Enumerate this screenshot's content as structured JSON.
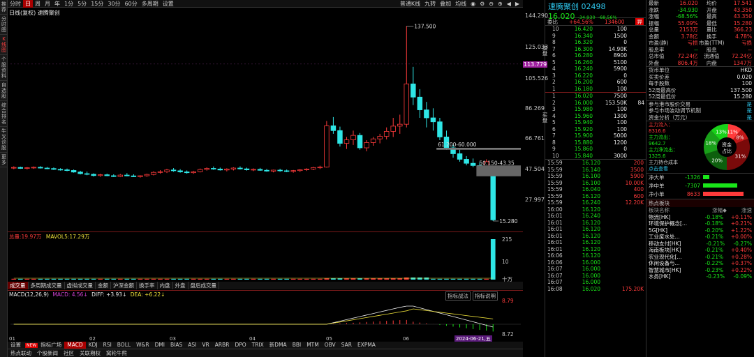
{
  "left_strip": [
    "推荐",
    "分时图",
    "K线图",
    "个股资料",
    "自选股",
    "综合排名",
    "牛叉诊股",
    "更多"
  ],
  "top_tabs": [
    "分时",
    "日",
    "周",
    "月",
    "年",
    "1分",
    "5分",
    "15分",
    "30分",
    "60分",
    "多周期",
    "设置"
  ],
  "top_right": [
    "普通K线",
    "九转",
    "叠加",
    "均线"
  ],
  "chart_title": "日线(复权)  速腾聚创",
  "price_axis": [
    "144.290",
    "125.033",
    "113.779",
    "105.526",
    "86.269",
    "66.761",
    "47.504",
    "27.997"
  ],
  "annotations": {
    "high": "137.500",
    "mark1": "61.200-60.000",
    "mark2": "50.150-43.35",
    "low": "15.280"
  },
  "vol_header": {
    "label": "总量:",
    "value": "19.97万",
    "mavol_label": "MAVOL5:",
    "mavol": "17.29万"
  },
  "vol_axis": [
    "215",
    "10",
    "十万"
  ],
  "vol_tabs": [
    "成交量",
    "多周期成交量",
    "虚拟成交量",
    "金额",
    "沪深金额",
    "换手率",
    "内盘",
    "外盘",
    "盘后成交量"
  ],
  "macd_header": {
    "label": "MACD(12,26,9)",
    "macd": "MACD: 4.56↓",
    "diff": "DIFF: +3.93↓",
    "dea": "DEA: +6.22↓"
  },
  "macd_buttons": [
    "指标战法",
    "指标说明"
  ],
  "macd_axis": [
    "8.79",
    "8.72"
  ],
  "date_axis": [
    "01",
    "02",
    "03",
    "04",
    "05",
    "06",
    "2024-06-21,五"
  ],
  "indicator_tabs": [
    "设置",
    "指标广场",
    "MACD",
    "KDJ",
    "RSI",
    "BOLL",
    "W&R",
    "DMI",
    "BIAS",
    "ASI",
    "VR",
    "ARBR",
    "DPO",
    "TRIX",
    "新DMA",
    "BBI",
    "MTM",
    "OBV",
    "SAR",
    "EXPMA"
  ],
  "new_badge": "NEW",
  "bottom_tabs": [
    "热点联动",
    "个股新闻",
    "社区",
    "关联期权",
    "窝轮牛熊"
  ],
  "stock": {
    "name": "速腾聚创",
    "code": "02498",
    "price": "16.020",
    "change": "-34.930",
    "pct": "-68.56%"
  },
  "weibi": {
    "label": "委比",
    "value": "+64.56%",
    "vol": "134600",
    "tag": "异"
  },
  "asks": [
    [
      "10",
      "16.420",
      "100"
    ],
    [
      "9",
      "16.340",
      "1500"
    ],
    [
      "8",
      "16.320",
      "0"
    ],
    [
      "7",
      "16.300",
      "14.90K"
    ],
    [
      "6",
      "16.280",
      "8900"
    ],
    [
      "5",
      "16.260",
      "5100"
    ],
    [
      "4",
      "16.240",
      "5900"
    ],
    [
      "3",
      "16.220",
      "0"
    ],
    [
      "2",
      "16.200",
      "600"
    ],
    [
      "1",
      "16.180",
      "100"
    ]
  ],
  "bids": [
    [
      "1",
      "16.020",
      "7500"
    ],
    [
      "2",
      "16.000",
      "153.50K"
    ],
    [
      "3",
      "15.980",
      "100"
    ],
    [
      "4",
      "15.960",
      "1300"
    ],
    [
      "5",
      "15.940",
      "100"
    ],
    [
      "6",
      "15.920",
      "100"
    ],
    [
      "7",
      "15.900",
      "5000"
    ],
    [
      "8",
      "15.880",
      "1200"
    ],
    [
      "9",
      "15.860",
      "0"
    ],
    [
      "10",
      "15.840",
      "3000"
    ]
  ],
  "bid_side_extra": "84",
  "ask_label": "卖盘",
  "bid_label": "买盘",
  "ticks": [
    [
      "15:59",
      "16.120",
      "200"
    ],
    [
      "15:59",
      "16.140",
      "3500"
    ],
    [
      "15:59",
      "16.100",
      "5900"
    ],
    [
      "15:59",
      "16.100",
      "10.00K"
    ],
    [
      "15:59",
      "16.040",
      "400"
    ],
    [
      "15:59",
      "16.120",
      "600"
    ],
    [
      "15:59",
      "16.240",
      "12.20K"
    ],
    [
      "16:00",
      "16.120",
      ""
    ],
    [
      "16:01",
      "16.240",
      ""
    ],
    [
      "16:01",
      "16.120",
      ""
    ],
    [
      "16:01",
      "16.120",
      ""
    ],
    [
      "16:01",
      "16.120",
      ""
    ],
    [
      "16:01",
      "16.120",
      ""
    ],
    [
      "16:01",
      "16.120",
      ""
    ],
    [
      "16:06",
      "16.120",
      ""
    ],
    [
      "16:06",
      "16.000",
      ""
    ],
    [
      "16:07",
      "16.000",
      ""
    ],
    [
      "16:07",
      "16.000",
      ""
    ],
    [
      "16:07",
      "16.000",
      ""
    ],
    [
      "16:08",
      "16.020",
      "175.20K"
    ]
  ],
  "quote": [
    [
      "最新",
      "16.020",
      "均价",
      "17.541"
    ],
    [
      "涨跌",
      "-34.930",
      "开盘",
      "43.350"
    ],
    [
      "涨幅",
      "-68.56%",
      "最高",
      "43.350"
    ],
    [
      "振幅",
      "55.09%",
      "最低",
      "15.280"
    ],
    [
      "总量",
      "2153万",
      "量比",
      "366.23"
    ],
    [
      "金额",
      "3.78亿",
      "换手",
      "4.78%"
    ],
    [
      "市盈(静)",
      "亏损",
      "市盈(TTM)",
      "亏损"
    ],
    [
      "股息率",
      "--",
      "股息",
      "--"
    ],
    [
      "总市值",
      "72.24亿",
      "流通值",
      "72.24亿"
    ],
    [
      "外盘",
      "806.4万",
      "内盘",
      "1347万"
    ]
  ],
  "extra": [
    [
      "货币单位",
      "HKD"
    ],
    [
      "买卖价差",
      "0.020"
    ],
    [
      "每手股数",
      "100"
    ],
    [
      "52周最高价",
      "137.500"
    ],
    [
      "52周最低价",
      "15.280"
    ]
  ],
  "links": [
    [
      "参与港市股价交易",
      "是"
    ],
    [
      "参与市场波动调节机制",
      "是"
    ],
    [
      "资金分析（万元）",
      "是"
    ]
  ],
  "fund_flow": {
    "in_label": "主力流入：",
    "in": "8316.6",
    "out_label": "主力流出：",
    "out": "9642.7",
    "net_label": "主力净流出：",
    "net": "1325.6",
    "cost_label": "主力持仓成本",
    "link": "点击查看"
  },
  "pie": {
    "center1": "资金",
    "center2": "占比",
    "slices": [
      [
        "11%",
        "#ff3b3b"
      ],
      [
        "8%",
        "#c01818"
      ],
      [
        "31%",
        "#7a0a0a"
      ],
      [
        "20%",
        "#0d5f0d"
      ],
      [
        "18%",
        "#19a019"
      ],
      [
        "13%",
        "#19d219"
      ]
    ]
  },
  "net": [
    [
      "净大单",
      "-1326",
      "#19e619"
    ],
    [
      "净中单",
      "-7307",
      "#19e619"
    ],
    [
      "净小单",
      "8633",
      "#ff3b3b"
    ]
  ],
  "hot": {
    "title": "热点板块",
    "headers": [
      "板块名称",
      "涨幅◆",
      "涨速"
    ],
    "rows": [
      [
        "物流[HK]",
        "-0.18%",
        "+0.11%"
      ],
      [
        "环境保护概念[...",
        "-0.18%",
        "+0.21%"
      ],
      [
        "5G[HK]",
        "-0.20%",
        "+1.22%"
      ],
      [
        "工业废水处...",
        "-0.21%",
        "+0.00%"
      ],
      [
        "移动支付[HK]",
        "-0.21%",
        "-0.27%"
      ],
      [
        "海南板块[HK]",
        "-0.21%",
        "+0.40%"
      ],
      [
        "农业现代化[...",
        "-0.21%",
        "+0.28%"
      ],
      [
        "休闲设备与...",
        "-0.22%",
        "+0.37%"
      ],
      [
        "智慧城市[HK]",
        "-0.23%",
        "+0.22%"
      ],
      [
        "水务[HK]",
        "-0.23%",
        "-0.09%"
      ]
    ]
  },
  "chart_data": {
    "type": "candlestick",
    "ylim": [
      15.28,
      144.29
    ],
    "candles": [
      [
        48.6,
        49.6,
        47.8,
        48.9
      ],
      [
        48.9,
        49.4,
        48.0,
        48.3
      ],
      [
        48.3,
        49.1,
        47.6,
        48.7
      ],
      [
        48.7,
        49.5,
        48.0,
        49.0
      ],
      [
        49.0,
        49.7,
        48.2,
        48.5
      ],
      [
        48.5,
        49.2,
        47.8,
        48.2
      ],
      [
        48.2,
        48.9,
        47.3,
        47.7
      ],
      [
        47.7,
        48.4,
        46.9,
        47.4
      ],
      [
        47.4,
        48.2,
        46.5,
        47.0
      ],
      [
        47.0,
        47.6,
        45.6,
        46.0
      ],
      [
        46.0,
        46.8,
        44.5,
        45.0
      ],
      [
        45.0,
        46.3,
        44.0,
        44.6
      ],
      [
        44.6,
        45.2,
        43.2,
        43.8
      ],
      [
        43.8,
        44.9,
        43.0,
        44.3
      ],
      [
        44.3,
        45.0,
        43.4,
        43.7
      ],
      [
        43.7,
        44.6,
        42.9,
        43.2
      ],
      [
        43.2,
        44.8,
        42.8,
        44.1
      ],
      [
        44.1,
        45.3,
        43.3,
        43.6
      ],
      [
        43.6,
        44.6,
        42.9,
        43.1
      ],
      [
        43.1,
        44.0,
        42.5,
        43.7
      ],
      [
        43.7,
        45.0,
        43.0,
        44.5
      ],
      [
        44.5,
        46.5,
        43.9,
        45.8
      ],
      [
        45.8,
        47.2,
        45.0,
        46.2
      ],
      [
        46.2,
        48.0,
        45.4,
        47.3
      ],
      [
        47.3,
        48.5,
        46.2,
        46.8
      ],
      [
        46.8,
        47.8,
        45.6,
        46.1
      ],
      [
        46.1,
        47.0,
        45.0,
        45.6
      ],
      [
        45.6,
        46.8,
        44.9,
        46.2
      ],
      [
        46.2,
        48.2,
        45.8,
        47.6
      ],
      [
        47.6,
        49.0,
        46.9,
        48.3
      ],
      [
        48.3,
        49.5,
        47.4,
        47.9
      ],
      [
        47.9,
        48.8,
        46.9,
        47.3
      ],
      [
        47.3,
        48.4,
        46.4,
        47.9
      ],
      [
        47.9,
        49.0,
        47.0,
        48.5
      ],
      [
        48.5,
        49.6,
        47.6,
        48.0
      ],
      [
        48.0,
        48.8,
        46.9,
        47.4
      ],
      [
        47.4,
        48.3,
        46.6,
        47.7
      ],
      [
        47.7,
        48.6,
        46.8,
        47.1
      ],
      [
        47.1,
        48.0,
        46.2,
        46.6
      ],
      [
        46.6,
        47.5,
        45.8,
        47.2
      ],
      [
        47.2,
        48.1,
        46.2,
        46.8
      ],
      [
        46.8,
        47.6,
        45.9,
        46.4
      ],
      [
        46.4,
        47.3,
        45.6,
        46.9
      ],
      [
        46.9,
        47.8,
        46.0,
        47.4
      ],
      [
        47.4,
        48.4,
        46.7,
        47.9
      ],
      [
        47.9,
        49.3,
        47.2,
        48.8
      ],
      [
        48.8,
        50.0,
        47.9,
        49.1
      ],
      [
        49.1,
        78.0,
        48.8,
        75.0
      ],
      [
        75.0,
        80.5,
        70.0,
        72.0
      ],
      [
        72.0,
        74.5,
        62.0,
        64.0
      ],
      [
        64.0,
        68.0,
        60.5,
        66.2
      ],
      [
        66.2,
        72.0,
        63.0,
        69.0
      ],
      [
        69.0,
        70.5,
        60.0,
        61.2
      ],
      [
        61.2,
        66.0,
        59.0,
        64.5
      ],
      [
        64.5,
        68.0,
        62.5,
        66.8
      ],
      [
        66.8,
        70.0,
        64.0,
        68.4
      ],
      [
        68.4,
        74.0,
        66.5,
        71.5
      ],
      [
        71.5,
        80.0,
        68.0,
        74.8
      ],
      [
        74.8,
        82.0,
        70.0,
        76.0
      ],
      [
        76.0,
        137.5,
        74.0,
        101.3
      ],
      [
        101.3,
        112.0,
        88.0,
        93.0
      ],
      [
        93.0,
        98.0,
        80.0,
        85.0
      ],
      [
        85.0,
        90.0,
        74.0,
        80.0
      ],
      [
        80.0,
        86.0,
        72.0,
        77.5
      ],
      [
        77.5,
        80.0,
        66.0,
        68.0
      ],
      [
        68.0,
        72.0,
        60.0,
        61.2
      ],
      [
        61.2,
        63.0,
        55.0,
        57.5
      ],
      [
        57.5,
        60.0,
        52.5,
        54.0
      ],
      [
        54.0,
        56.0,
        50.2,
        51.5
      ],
      [
        51.5,
        54.5,
        49.0,
        50.1
      ],
      [
        50.1,
        52.0,
        48.0,
        49.5
      ],
      [
        49.5,
        54.0,
        49.0,
        52.5
      ],
      [
        43.35,
        43.35,
        15.28,
        16.02
      ]
    ]
  }
}
